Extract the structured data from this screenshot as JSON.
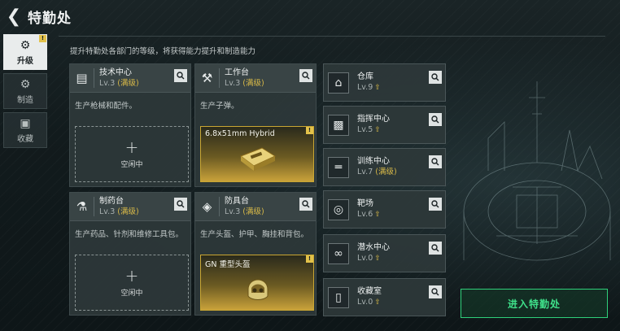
{
  "header": {
    "back_icon": "back-arrow-icon",
    "title": "特勤处"
  },
  "side_nav": [
    {
      "label": "升级",
      "icon": "upgrade-icon",
      "active": true,
      "badge": "!"
    },
    {
      "label": "制造",
      "icon": "gear-icon",
      "active": false
    },
    {
      "label": "收藏",
      "icon": "collection-icon",
      "active": false
    }
  ],
  "intro": "提升特勤处各部门的等级，将获得能力提升和制造能力",
  "departments": [
    {
      "name": "技术中心",
      "level": "Lv.3",
      "max": "(满级)",
      "desc": "生产枪械和配件。",
      "slot": {
        "type": "empty",
        "label": "空闲中"
      }
    },
    {
      "name": "工作台",
      "level": "Lv.3",
      "max": "(满级)",
      "desc": "生产子弹。",
      "slot": {
        "type": "item",
        "name": "6.8x51mm Hybrid",
        "badge": "!"
      }
    },
    {
      "name": "制药台",
      "level": "Lv.3",
      "max": "(满级)",
      "desc": "生产药品、针剂和维修工具包。",
      "slot": {
        "type": "empty",
        "label": "空闲中"
      }
    },
    {
      "name": "防具台",
      "level": "Lv.3",
      "max": "(满级)",
      "desc": "生产头盔、护甲、胸挂和背包。",
      "slot": {
        "type": "item",
        "name": "GN 重型头盔",
        "badge": "!"
      }
    }
  ],
  "facilities": [
    {
      "name": "仓库",
      "level": "Lv.9",
      "max": "",
      "upgradable": true,
      "icon": "warehouse-icon"
    },
    {
      "name": "指挥中心",
      "level": "Lv.5",
      "max": "",
      "upgradable": true,
      "icon": "command-center-icon"
    },
    {
      "name": "训练中心",
      "level": "Lv.7",
      "max": "(满级)",
      "upgradable": false,
      "icon": "dumbbell-icon"
    },
    {
      "name": "靶场",
      "level": "Lv.6",
      "max": "",
      "upgradable": true,
      "icon": "target-icon"
    },
    {
      "name": "潜水中心",
      "level": "Lv.0",
      "max": "",
      "upgradable": true,
      "icon": "diving-goggles-icon"
    },
    {
      "name": "收藏室",
      "level": "Lv.0",
      "max": "",
      "upgradable": true,
      "icon": "display-case-icon"
    }
  ],
  "enter_button": "进入特勤处",
  "colors": {
    "accent_gold": "#d8b948",
    "accent_green": "#3fe08a"
  }
}
